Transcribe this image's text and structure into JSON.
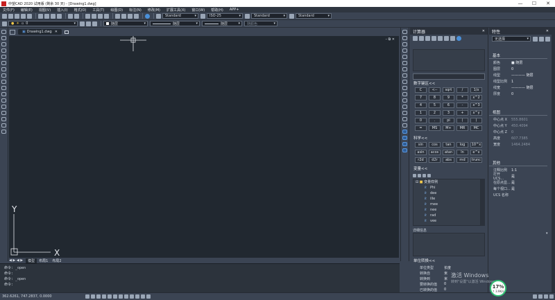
{
  "window": {
    "title": "中望CAD 2020 试用版 (剩余 30 天) - [Drawing1.dwg]",
    "minimize": "—",
    "maximize": "☐",
    "close": "✕"
  },
  "menu": [
    "文件(F)",
    "编辑(E)",
    "视图(V)",
    "插入(I)",
    "格式(O)",
    "工具(T)",
    "绘图(D)",
    "标注(N)",
    "修改(M)",
    "扩展工具(X)",
    "窗口(W)",
    "帮助(H)",
    "APP+"
  ],
  "toolbar1": {
    "text_style": "Standard",
    "dim_style": "ISO-25",
    "table_style": "Standard",
    "multileader_style": "Standard"
  },
  "toolbar2": {
    "layer": "0",
    "color": "随层",
    "linetype": "随层",
    "lineweight": "随层",
    "plotstyle": "随颜色"
  },
  "tabs": {
    "doc": "Drawing1.dwg",
    "model": "模型",
    "layout1": "布局1",
    "layout2": "布局2"
  },
  "canvas": {
    "ucs_y": "Y",
    "ucs_x": "X",
    "bg": "#212830"
  },
  "command": {
    "lines": [
      "命令: _open",
      "命令:",
      "命令: _open",
      "命令:"
    ]
  },
  "status": {
    "coords": "362.6261, 747.2837, 0.0000"
  },
  "calculator": {
    "title": "计算器",
    "numpad_title": "数字键区<<",
    "numpad": [
      "C",
      "<--",
      "sqrt",
      "/",
      "1/x",
      "7",
      "8",
      "9",
      "*",
      "x^2",
      "4",
      "5",
      "6",
      "-",
      "x^3",
      "1",
      "2",
      "3",
      "+",
      "x^y",
      "0",
      ".",
      "pi",
      "(",
      ")",
      "=",
      "MS",
      "M+",
      "MR",
      "MC"
    ],
    "sci_title": "科学<<",
    "sci": [
      "sin",
      "cos",
      "tan",
      "log",
      "10^x",
      "asin",
      "acos",
      "atan",
      "ln",
      "e^x",
      "r2d",
      "d2r",
      "abs",
      "rnd",
      "trunc"
    ],
    "vars_title": "变量<<",
    "vars_group": "变量样例",
    "vars": [
      "Phi",
      "dee",
      "ille",
      "mee",
      "nee",
      "rad",
      "vee"
    ],
    "details_label": "详细信息",
    "units_title": "单位转换<<",
    "units_header": [
      "单位类型",
      "长度"
    ],
    "units_rows": [
      [
        "转换自",
        "米"
      ],
      [
        "转换到",
        "米"
      ],
      [
        "要转换的值",
        "0"
      ],
      [
        "已转换的值",
        "0"
      ]
    ]
  },
  "properties": {
    "title": "特性",
    "selection": "无选择",
    "basic_title": "基本",
    "basic": [
      [
        "颜色",
        "■ 随层"
      ],
      [
        "图层",
        "0"
      ],
      [
        "线型",
        "———— 随层"
      ],
      [
        "线型比例",
        "1"
      ],
      [
        "线宽",
        "———— 随层"
      ],
      [
        "厚度",
        "0"
      ]
    ],
    "view_title": "视图",
    "view": [
      [
        "中心点 X",
        "555.8601"
      ],
      [
        "中心点 Y",
        "450.4094"
      ],
      [
        "中心点 Z",
        "0"
      ],
      [
        "高度",
        "607.7385"
      ],
      [
        "宽度",
        "1464.2484"
      ]
    ],
    "other_title": "其他",
    "other": [
      [
        "注释比例",
        "1:1"
      ],
      [
        "打开 UCS...",
        "是"
      ],
      [
        "在原点显...",
        "是"
      ],
      [
        "每个视口...",
        "是"
      ],
      [
        "UCS 名称",
        ""
      ]
    ]
  },
  "overlay": {
    "activate1": "激活 Windows",
    "activate2": "转到\"设置\"以激活 Windows。",
    "cpu": "17%",
    "net": "↑ 3.9K/s"
  }
}
